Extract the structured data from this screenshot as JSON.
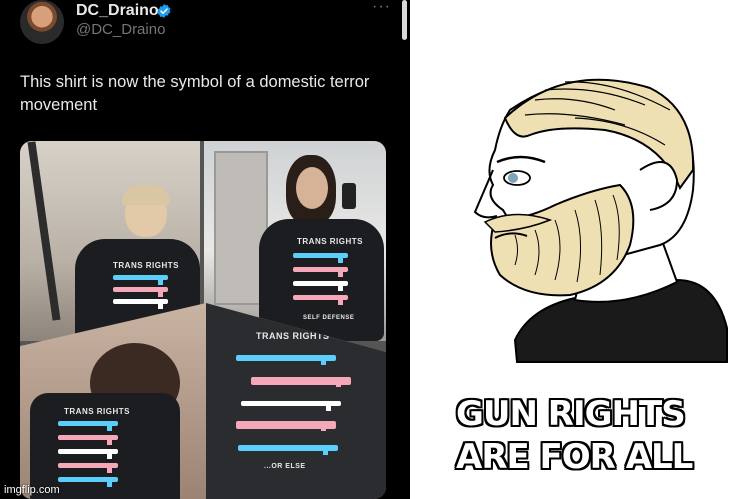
{
  "tweet": {
    "display_name": "DC_Draino",
    "handle": "@DC_Draino",
    "more_label": "···",
    "text": "This shirt is now the symbol of a domestic terror movement",
    "shirt_prints": {
      "photo_1": "TRANS RIGHTS",
      "photo_2": "TRANS RIGHTS",
      "photo_2_bottom": "SELF DEFENSE",
      "photo_3": "TRANS RIGHTS",
      "photo_4": "TRANS RIGHTS",
      "photo_4_bottom": "...OR ELSE"
    },
    "gun_colors": [
      "#5bcefa",
      "#f5a9b8",
      "#ffffff",
      "#f5a9b8",
      "#5bcefa"
    ],
    "verified_color": "#1d9bf0"
  },
  "watermark": "imgflip.com",
  "meme": {
    "caption_line_1": "GUN RIGHTS",
    "caption_line_2": "ARE FOR ALL"
  },
  "colors": {
    "tweet_background": "#000000",
    "tweet_text": "#e7e9ea",
    "handle_text": "#71767b",
    "chad_hair": "#efe0b4",
    "chad_shirt": "#1a1a1a"
  }
}
